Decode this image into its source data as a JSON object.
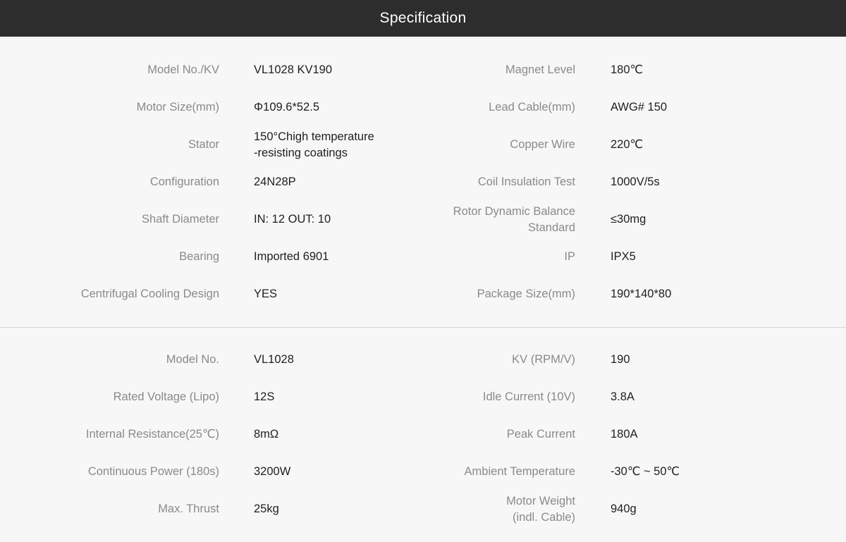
{
  "header": {
    "title": "Specification"
  },
  "specs_top": [
    {
      "label1": "Model No./KV",
      "value1": "VL1028 KV190",
      "label2": "Magnet Level",
      "value2": "180℃"
    },
    {
      "label1": "Motor Size(mm)",
      "value1": "Φ109.6*52.5",
      "label2": "Lead Cable(mm)",
      "value2": "AWG# 150"
    },
    {
      "label1": "Stator",
      "value1": "150°Chigh temperature\n-resisting coatings",
      "label2": "Copper Wire",
      "value2": "220℃"
    },
    {
      "label1": "Configuration",
      "value1": "24N28P",
      "label2": "Coil Insulation Test",
      "value2": "1000V/5s"
    },
    {
      "label1": "Shaft Diameter",
      "value1": "IN: 12  OUT: 10",
      "label2": "Rotor Dynamic Balance\nStandard",
      "value2": "≤30mg"
    },
    {
      "label1": "Bearing",
      "value1": "Imported 6901",
      "label2": "IP",
      "value2": "IPX5"
    },
    {
      "label1": "Centrifugal Cooling Design",
      "value1": "YES",
      "label2": "Package Size(mm)",
      "value2": "190*140*80"
    }
  ],
  "specs_bottom": [
    {
      "label1": "Model No.",
      "value1": "VL1028",
      "label2": "KV (RPM/V)",
      "value2": "190"
    },
    {
      "label1": "Rated Voltage (Lipo)",
      "value1": "12S",
      "label2": "Idle Current (10V)",
      "value2": "3.8A"
    },
    {
      "label1": "Internal Resistance(25℃)",
      "value1": "8mΩ",
      "label2": "Peak Current",
      "value2": "180A"
    },
    {
      "label1": "Continuous Power (180s)",
      "value1": "3200W",
      "label2": "Ambient Temperature",
      "value2": "-30℃ ~ 50℃"
    },
    {
      "label1": "Max. Thrust",
      "value1": "25kg",
      "label2": "Motor Weight\n(indl. Cable)",
      "value2": "940g"
    }
  ]
}
